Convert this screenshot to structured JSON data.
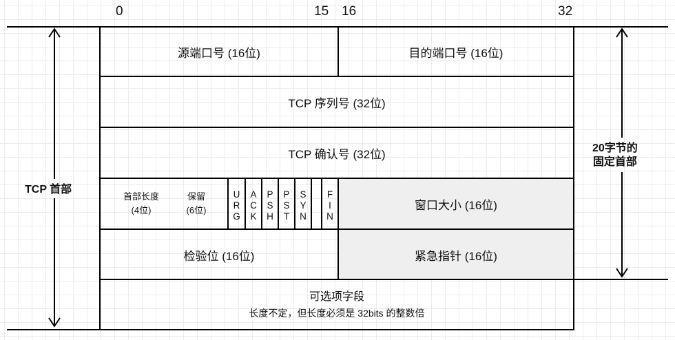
{
  "ruler": {
    "b0": "0",
    "b15": "15",
    "b16": "16",
    "b32": "32"
  },
  "rows": {
    "src_port": "源端口号 (16位)",
    "dst_port": "目的端口号 (16位)",
    "seq": "TCP 序列号 (32位)",
    "ack": "TCP 确认号 (32位)",
    "header_len": "首部长度",
    "header_len_bits": "(4位)",
    "reserved": "保留",
    "reserved_bits": "(6位)",
    "window": "窗口大小 (16位)",
    "checksum": "检验位 (16位)",
    "urgent": "紧急指针  (16位)",
    "options": "可选项字段",
    "options_note": "长度不定，但长度必须是 32bits 的整数倍"
  },
  "flags": [
    {
      "c1": "U",
      "c2": "R",
      "c3": "G"
    },
    {
      "c1": "A",
      "c2": "C",
      "c3": "K"
    },
    {
      "c1": "P",
      "c2": "S",
      "c3": "H"
    },
    {
      "c1": "P",
      "c2": "S",
      "c3": "T"
    },
    {
      "c1": "S",
      "c2": "Y",
      "c3": "N"
    },
    {
      "c1": "F",
      "c2": "I",
      "c3": "N"
    }
  ],
  "labels": {
    "tcp_header": "TCP 首部",
    "fixed_line1": "20字节的",
    "fixed_line2": "固定首部"
  },
  "colors": {
    "shaded": "#efefef",
    "line": "#000000"
  }
}
